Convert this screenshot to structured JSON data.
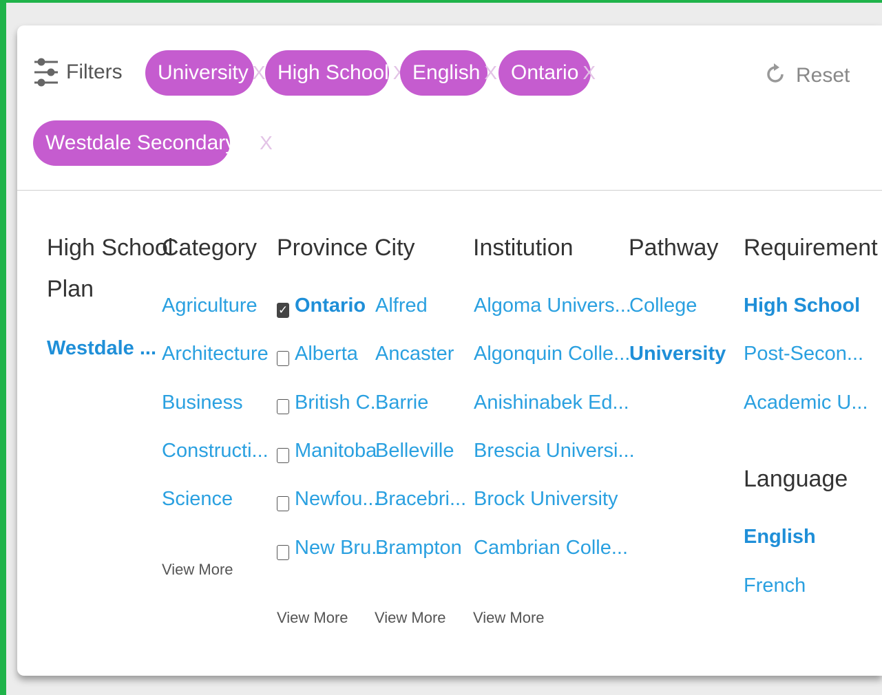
{
  "header": {
    "filters_label": "Filters",
    "reset_label": "Reset",
    "chips": [
      "University",
      "High School",
      "English",
      "Ontario",
      "Westdale Secondary..."
    ],
    "chip_remove": "X"
  },
  "columns": {
    "plan": {
      "title_line1": "High School",
      "title_line2": "Plan",
      "items": [
        "Westdale ..."
      ]
    },
    "category": {
      "title": "Category",
      "items": [
        "Agriculture",
        "Architecture",
        "Business",
        "Constructi...",
        "Science"
      ],
      "view_more": "View More"
    },
    "province": {
      "title": "Province",
      "items": [
        "Ontario",
        "Alberta",
        "British C...",
        "Manitoba",
        "Newfou...",
        "New Bru..."
      ],
      "checked": [
        true,
        false,
        false,
        false,
        false,
        false
      ],
      "view_more": "View More"
    },
    "city": {
      "title": "City",
      "items": [
        "Alfred",
        "Ancaster",
        "Barrie",
        "Belleville",
        "Bracebri...",
        "Brampton"
      ],
      "view_more": "View More"
    },
    "institution": {
      "title": "Institution",
      "items": [
        "Algoma Univers...",
        "Algonquin Colle...",
        "Anishinabek Ed...",
        "Brescia Universi...",
        "Brock University",
        "Cambrian Colle..."
      ],
      "view_more": "View More"
    },
    "pathway": {
      "title": "Pathway",
      "items": [
        "College",
        "University"
      ]
    },
    "requirement": {
      "title": "Requirement",
      "items": [
        "High School",
        "Post-Secon...",
        "Academic U..."
      ]
    },
    "language": {
      "title": "Language",
      "items": [
        "English",
        "French"
      ]
    }
  },
  "colors": {
    "chip": "#c55ccf",
    "link": "#2aa0e0",
    "border": "#1fb34a"
  }
}
